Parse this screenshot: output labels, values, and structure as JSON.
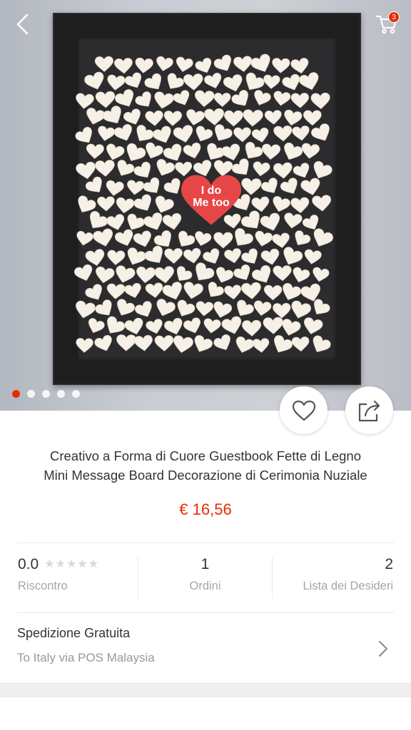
{
  "hero": {
    "center_heart_line1": "I do",
    "center_heart_line2": "Me too",
    "accent_heart_color": "#e64646",
    "wood_heart_color": "#f6f0e6",
    "frame_color": "#1e1e1f"
  },
  "nav": {
    "back_icon": "chevron-left-icon",
    "cart_icon": "shopping-cart-icon",
    "cart_count": "3"
  },
  "carousel": {
    "total": 5,
    "active_index": 0
  },
  "actions": {
    "wishlist_icon": "heart-outline-icon",
    "share_icon": "share-icon"
  },
  "product": {
    "title_line1": "Creativo a Forma di Cuore Guestbook Fette di Legno",
    "title_line2": "Mini Message Board Decorazione di Cerimonia Nuziale",
    "price": "€ 16,56"
  },
  "stats": {
    "rating_value": "0.0",
    "rating_stars": "★★★★★",
    "rating_label": "Riscontro",
    "orders_value": "1",
    "orders_label": "Ordini",
    "wishlist_value": "2",
    "wishlist_label": "Lista dei Desideri"
  },
  "shipping": {
    "title": "Spedizione Gratuita",
    "subtitle": "To Italy via POS Malaysia"
  },
  "colors": {
    "accent": "#e62e04",
    "muted_text": "#a6a6a6"
  }
}
